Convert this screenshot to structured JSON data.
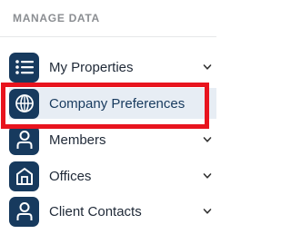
{
  "sidebar": {
    "section_title": "MANAGE DATA",
    "items": [
      {
        "label": "My Properties",
        "icon": "list-icon",
        "expandable": true
      },
      {
        "label": "Company Preferences",
        "icon": "globe-icon",
        "active": true,
        "highlighted": true
      },
      {
        "label": "Members",
        "icon": "person-icon",
        "expandable": true
      },
      {
        "label": "Offices",
        "icon": "building-icon",
        "expandable": true
      },
      {
        "label": "Client Contacts",
        "icon": "person-icon",
        "expandable": true
      }
    ]
  },
  "colors": {
    "icon_background": "#173a5e",
    "active_background": "#e7edf4",
    "highlight_border": "#e8141e",
    "section_title": "#8b8e92",
    "label_text": "#1f2937"
  }
}
